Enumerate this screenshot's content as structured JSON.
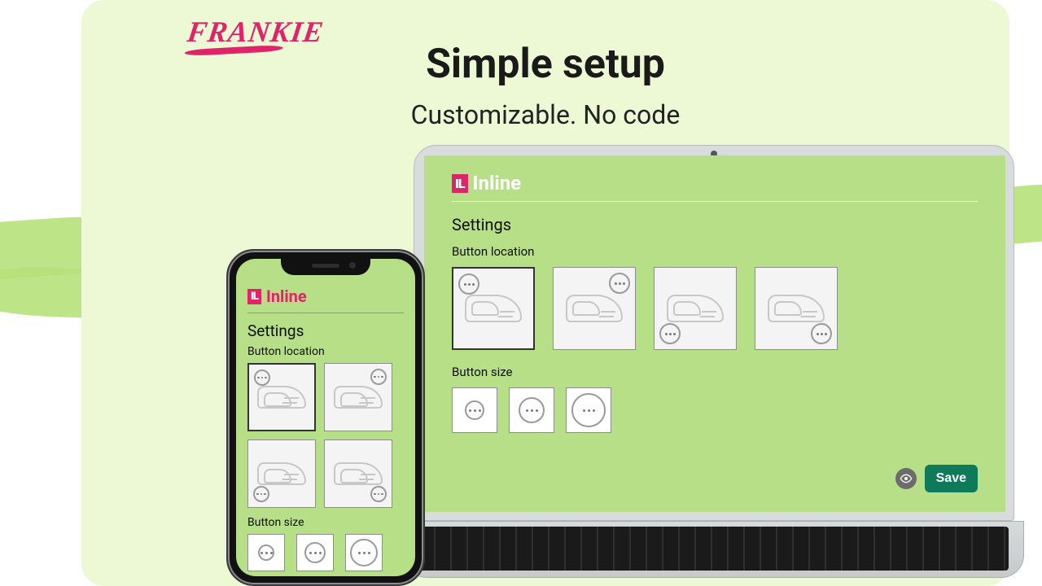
{
  "brand": "FRANKIE",
  "hero": {
    "title": "Simple setup",
    "subtitle": "Customizable. No code"
  },
  "screen": {
    "app_name": "Inline",
    "settings_title": "Settings",
    "button_location_label": "Button location",
    "button_size_label": "Button size",
    "save_label": "Save",
    "location_options": [
      "top-left",
      "top-right",
      "bottom-left",
      "bottom-right"
    ],
    "size_options": [
      "small",
      "medium",
      "large"
    ]
  },
  "colors": {
    "accent": "#e0246a",
    "save": "#0f7a5a",
    "panel": "#b6df87",
    "card": "#edf8d5"
  }
}
